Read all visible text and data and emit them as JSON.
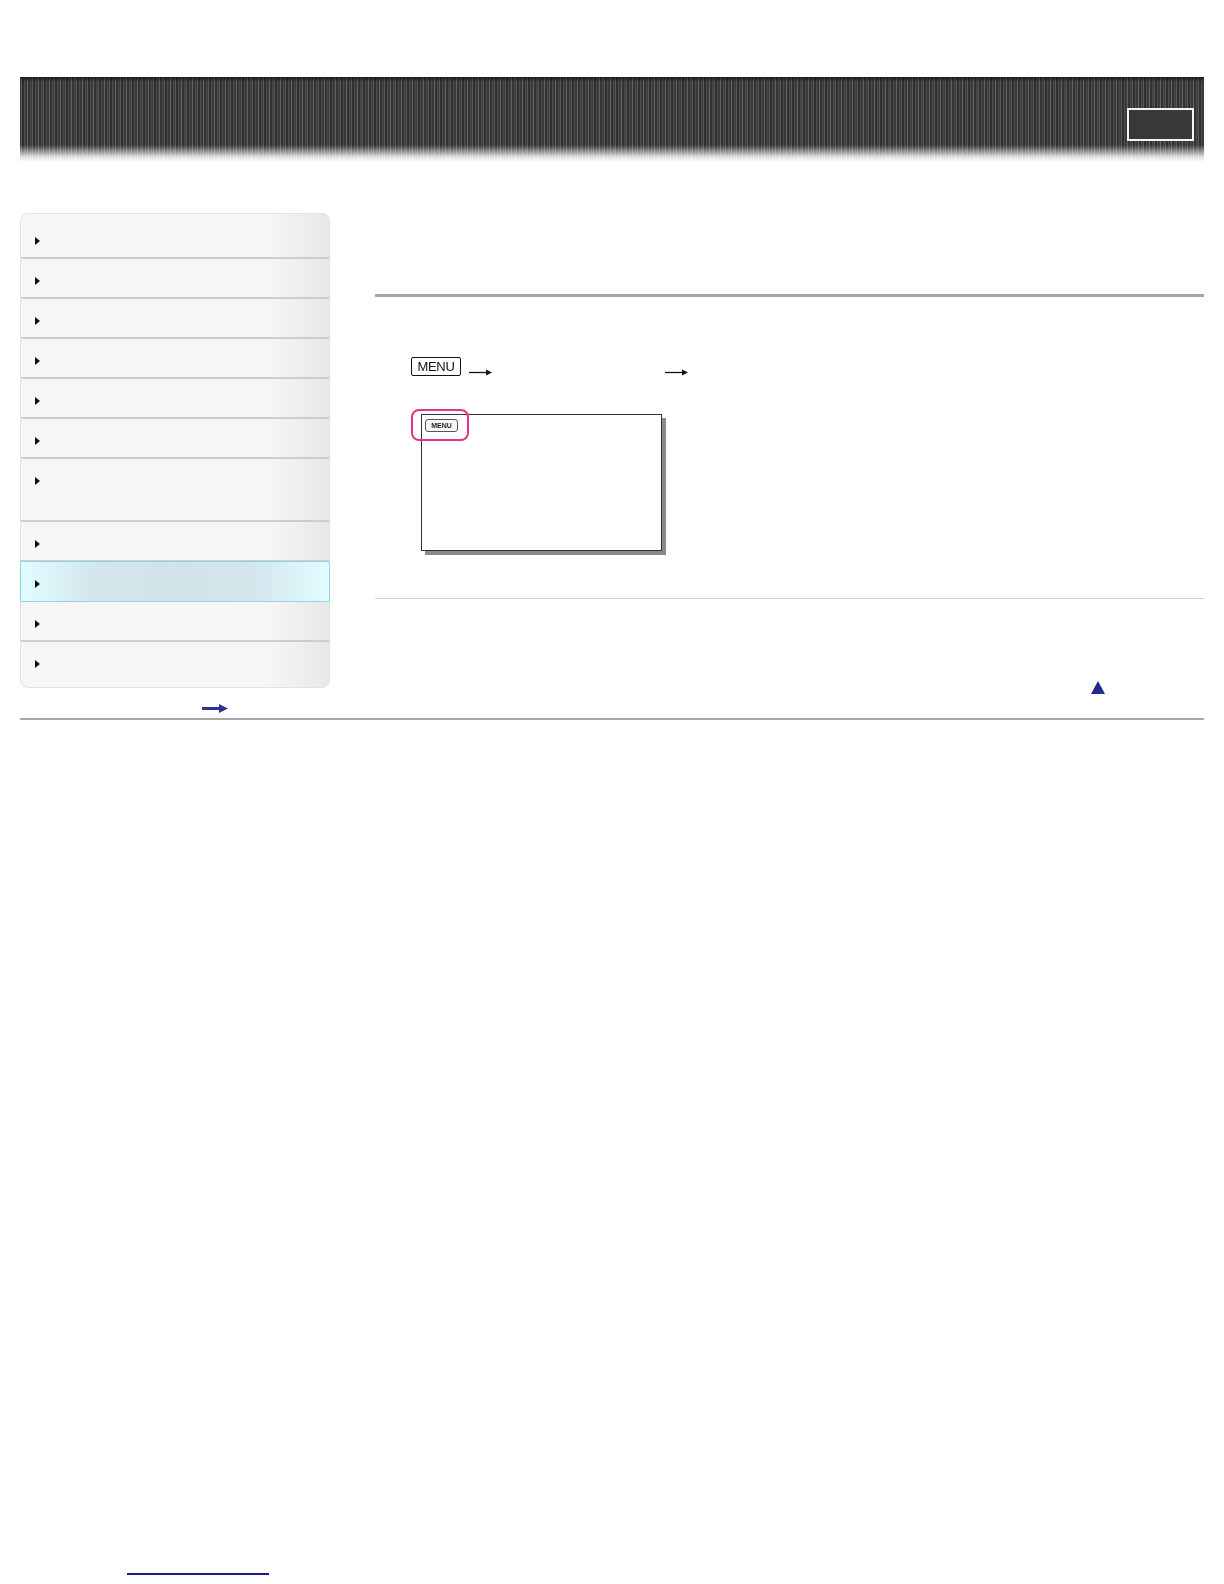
{
  "sidebar": {
    "items": [
      {
        "kind": "regular",
        "selected": false
      },
      {
        "kind": "regular",
        "selected": false
      },
      {
        "kind": "regular",
        "selected": false
      },
      {
        "kind": "regular",
        "selected": false
      },
      {
        "kind": "regular",
        "selected": false
      },
      {
        "kind": "regular",
        "selected": false
      },
      {
        "kind": "tall",
        "selected": false
      },
      {
        "kind": "regular",
        "selected": false
      },
      {
        "kind": "regular",
        "selected": true
      },
      {
        "kind": "regular",
        "selected": false
      },
      {
        "kind": "regular",
        "selected": false
      }
    ]
  },
  "procedure": {
    "key_label": "MENU"
  },
  "illustration": {
    "button_label": "MENU"
  }
}
